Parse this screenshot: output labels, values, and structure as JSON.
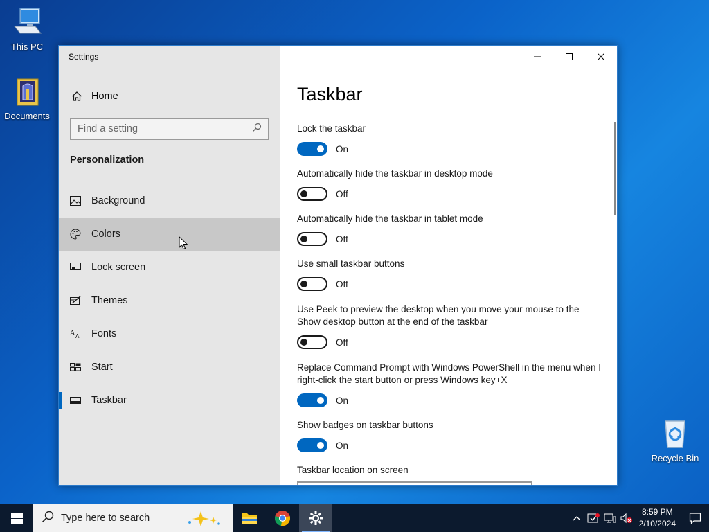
{
  "desktop": {
    "icons": [
      {
        "label": "This PC"
      },
      {
        "label": "Documents"
      },
      {
        "label": "Recycle Bin"
      }
    ]
  },
  "window": {
    "title": "Settings",
    "home_label": "Home",
    "search_placeholder": "Find a setting",
    "section_label": "Personalization",
    "nav": [
      {
        "label": "Background",
        "icon": "picture-icon"
      },
      {
        "label": "Colors",
        "icon": "palette-icon"
      },
      {
        "label": "Lock screen",
        "icon": "lock-screen-icon"
      },
      {
        "label": "Themes",
        "icon": "themes-icon"
      },
      {
        "label": "Fonts",
        "icon": "fonts-icon"
      },
      {
        "label": "Start",
        "icon": "start-icon"
      },
      {
        "label": "Taskbar",
        "icon": "taskbar-icon"
      }
    ],
    "hovered_item": "Colors",
    "active_item": "Taskbar"
  },
  "content": {
    "title": "Taskbar",
    "settings": [
      {
        "label": "Lock the taskbar",
        "state": "On"
      },
      {
        "label": "Automatically hide the taskbar in desktop mode",
        "state": "Off"
      },
      {
        "label": "Automatically hide the taskbar in tablet mode",
        "state": "Off"
      },
      {
        "label": "Use small taskbar buttons",
        "state": "Off"
      },
      {
        "label": "Use Peek to preview the desktop when you move your mouse to the Show desktop button at the end of the taskbar",
        "state": "Off"
      },
      {
        "label": "Replace Command Prompt with Windows PowerShell in the menu when I right-click the start button or press Windows key+X",
        "state": "On"
      },
      {
        "label": "Show badges on taskbar buttons",
        "state": "On"
      }
    ],
    "location_label": "Taskbar location on screen"
  },
  "taskbar": {
    "search_text": "Type here to search",
    "time": "8:59 PM",
    "date": "2/10/2024"
  },
  "colors": {
    "accent": "#0067c0",
    "sidebar_bg": "#e6e6e6",
    "taskbar_bg": "#0c1a2e"
  }
}
